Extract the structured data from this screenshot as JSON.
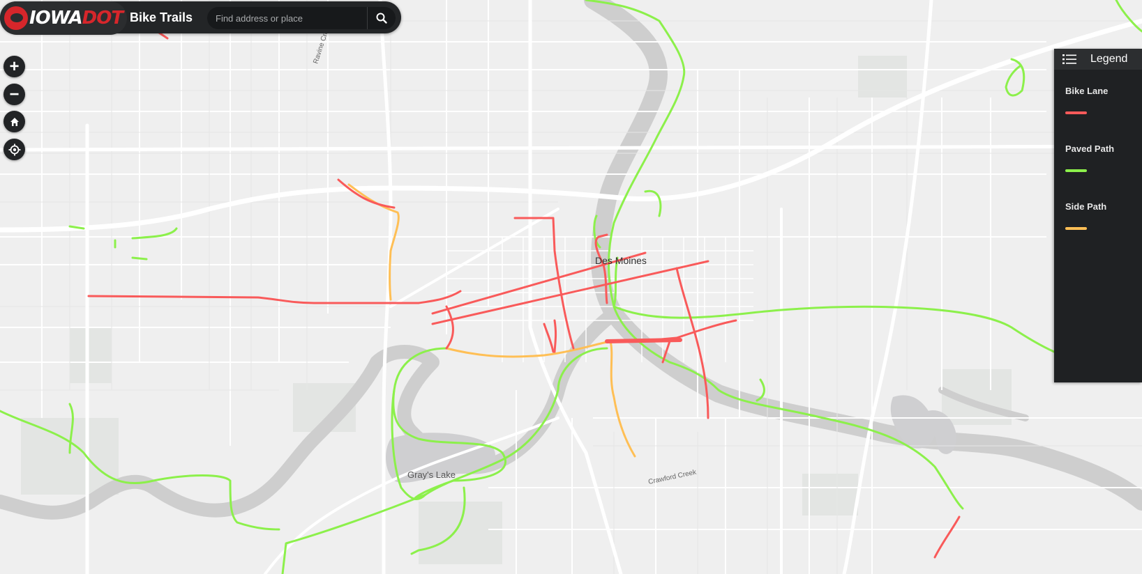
{
  "header": {
    "logo_text_white": "IOWA",
    "logo_text_red": "DOT",
    "app_title": "Bike Trails",
    "search_placeholder": "Find address or place"
  },
  "controls": {
    "zoom_in": "+",
    "zoom_out": "−",
    "home_icon": "home-icon",
    "locate_icon": "locate-icon"
  },
  "legend": {
    "title": "Legend",
    "items": [
      {
        "label": "Bike Lane",
        "color": "#f95a5a"
      },
      {
        "label": "Paved Path",
        "color": "#8cf04b"
      },
      {
        "label": "Side Path",
        "color": "#ffbf55"
      }
    ]
  },
  "map": {
    "city_label": "Des Moines",
    "lake_label": "Gray's Lake",
    "creek_ravine": "Ravine Creek",
    "creek_crawford": "Crawford Creek",
    "colors": {
      "bike_lane": "#f95a5a",
      "paved_path": "#8cf04b",
      "side_path": "#ffbf55",
      "river": "#cccccf",
      "land": "#eeeeee",
      "road": "#ffffff"
    }
  }
}
